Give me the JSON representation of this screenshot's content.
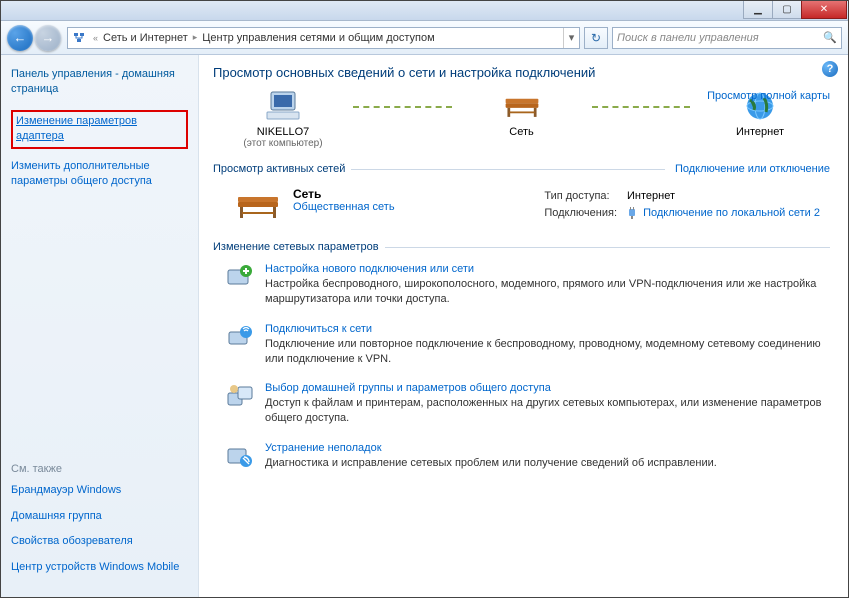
{
  "breadcrumb": {
    "seg1": "Сеть и Интернет",
    "seg2": "Центр управления сетями и общим доступом"
  },
  "search": {
    "placeholder": "Поиск в панели управления"
  },
  "sidebar": {
    "cp_home": "Панель управления - домашняя страница",
    "link_adapter": "Изменение параметров адаптера",
    "link_sharing": "Изменить дополнительные параметры общего доступа",
    "see_also": "См. также",
    "link_firewall": "Брандмауэр Windows",
    "link_homegroup": "Домашняя группа",
    "link_inet_opts": "Свойства обозревателя",
    "link_wmdc": "Центр устройств Windows Mobile"
  },
  "title": "Просмотр основных сведений о сети и настройка подключений",
  "map": {
    "node1_name": "NIKELLO7",
    "node1_sub": "(этот компьютер)",
    "node2_name": "Сеть",
    "node3_name": "Интернет",
    "full_map": "Просмотр полной карты"
  },
  "active": {
    "head": "Просмотр активных сетей",
    "right_link": "Подключение или отключение",
    "net_name": "Сеть",
    "net_type": "Общественная сеть",
    "access_lbl": "Тип доступа:",
    "access_val": "Интернет",
    "conn_lbl": "Подключения:",
    "conn_val": "Подключение по локальной сети 2"
  },
  "change": {
    "head": "Изменение сетевых параметров",
    "tasks": [
      {
        "title": "Настройка нового подключения или сети",
        "desc": "Настройка беспроводного, широкополосного, модемного, прямого или VPN-подключения или же настройка маршрутизатора или точки доступа."
      },
      {
        "title": "Подключиться к сети",
        "desc": "Подключение или повторное подключение к беспроводному, проводному, модемному сетевому соединению или подключение к VPN."
      },
      {
        "title": "Выбор домашней группы и параметров общего доступа",
        "desc": "Доступ к файлам и принтерам, расположенных на других сетевых компьютерах, или изменение параметров общего доступа."
      },
      {
        "title": "Устранение неполадок",
        "desc": "Диагностика и исправление сетевых проблем или получение сведений об исправлении."
      }
    ]
  }
}
